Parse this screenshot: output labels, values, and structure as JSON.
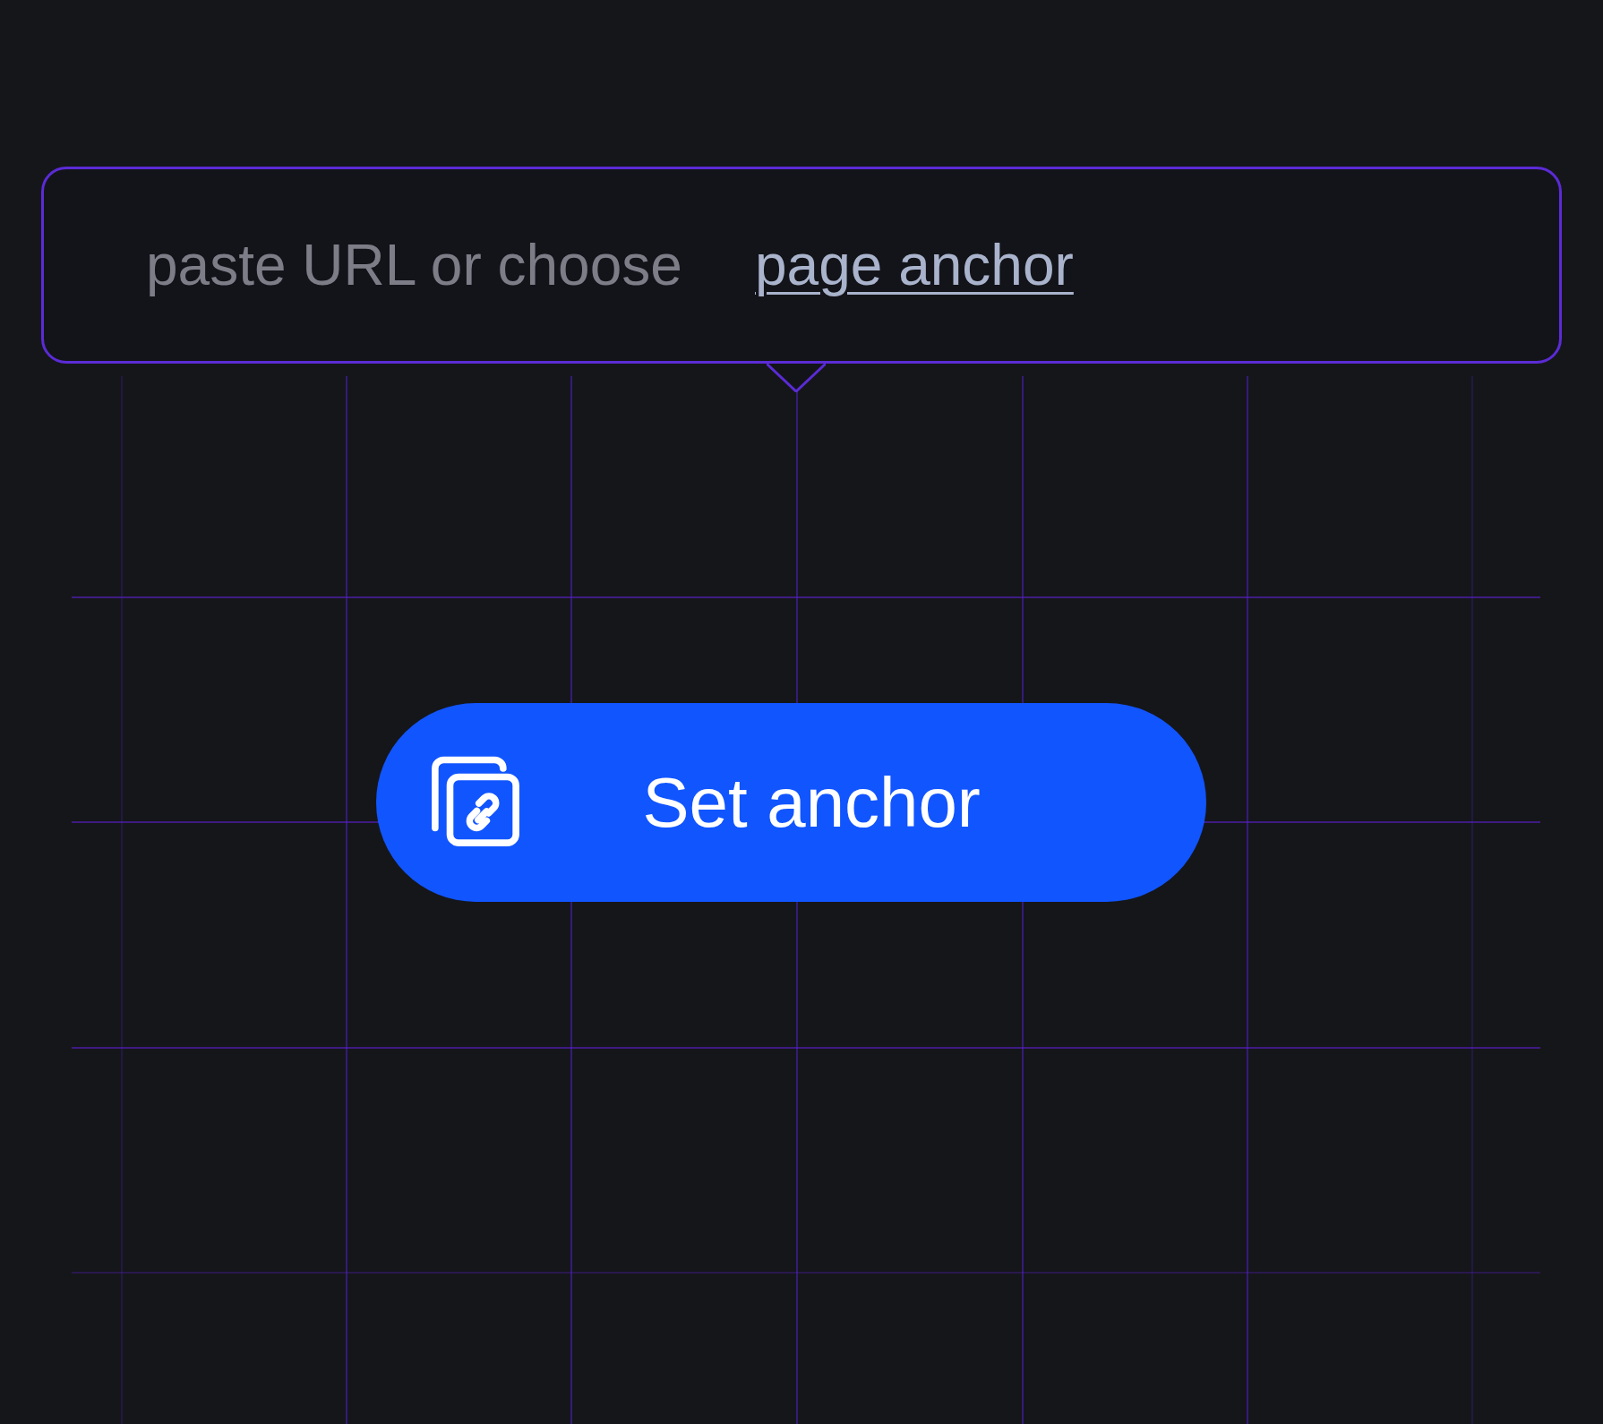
{
  "url_field": {
    "placeholder": "paste URL or choose",
    "link": "page anchor"
  },
  "button": {
    "label": "Set anchor"
  }
}
